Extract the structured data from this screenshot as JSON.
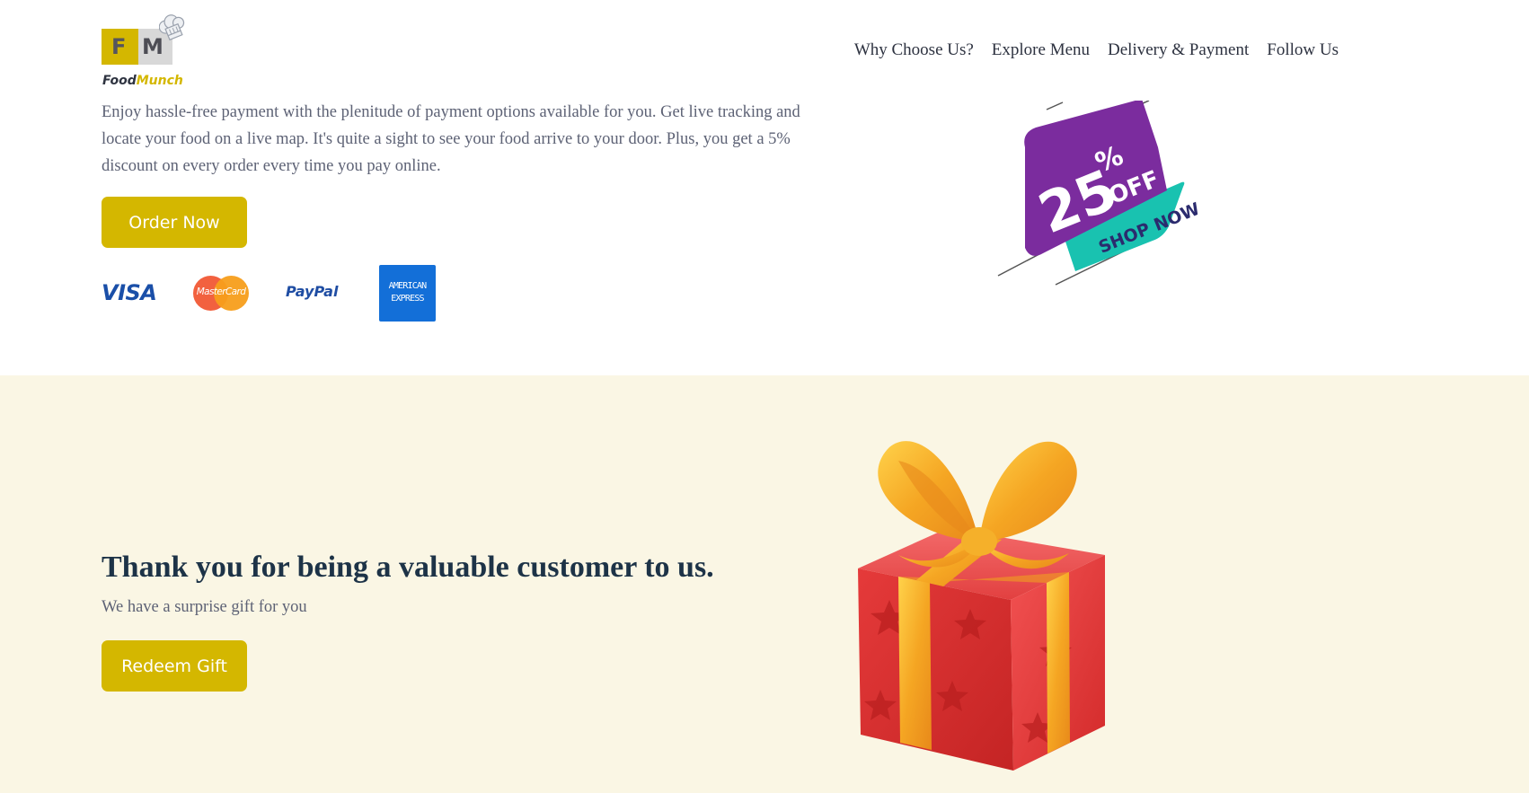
{
  "logo": {
    "box_letters": [
      "F",
      "M"
    ],
    "brand_part1": "Food",
    "brand_part2": "Munch",
    "icon": "chef-hat-icon"
  },
  "nav": {
    "items": [
      "Why Choose Us?",
      "Explore Menu",
      "Delivery & Payment",
      "Follow Us"
    ]
  },
  "delivery": {
    "description": "Enjoy hassle-free payment with the plenitude of payment options available for you. Get live tracking and locate your food on a live map. It's quite a sight to see your food arrive to your door. Plus, you get a 5% discount on every order every time you pay online.",
    "order_button": "Order Now",
    "payment_methods": {
      "visa": "VISA",
      "mastercard": "MasterCard",
      "paypal": "PayPal",
      "amex_line1": "AMERICAN",
      "amex_line2": "EXPRESS"
    },
    "offer": {
      "percent": "25",
      "percent_sign": "%",
      "off": "OFF",
      "cta": "SHOP NOW"
    }
  },
  "gift_section": {
    "heading": "Thank you for being a valuable customer to us.",
    "subtext": "We have a surprise gift for you",
    "redeem_button": "Redeem Gift",
    "image_icon": "gift-box-icon"
  },
  "colors": {
    "accent": "#d4b700",
    "heading": "#1d3347",
    "body_text": "#5d6275",
    "cream_background": "#faf6e4",
    "offer_purple": "#7b2c9e",
    "offer_teal": "#19c2b0"
  }
}
